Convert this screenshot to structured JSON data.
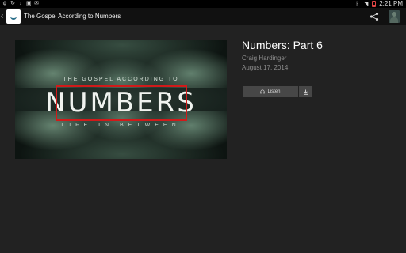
{
  "status_bar": {
    "time": "2:21 PM",
    "icons": [
      "usb-icon",
      "sync-icon",
      "download-notification-icon",
      "image-icon",
      "mail-icon",
      "bluetooth-icon",
      "wifi-icon",
      "battery-icon"
    ]
  },
  "action_bar": {
    "title": "The Gospel According to Numbers"
  },
  "artwork": {
    "kicker": "THE GOSPEL ACCORDING TO",
    "title": "NUMBERS",
    "tagline": "LIFE IN BETWEEN"
  },
  "episode": {
    "title": "Numbers: Part 6",
    "author": "Craig Hardinger",
    "date": "August 17, 2014"
  },
  "actions": {
    "listen_label": "Listen"
  },
  "colors": {
    "background": "#222222",
    "action_bar": "#111111",
    "button": "#474747",
    "highlight_frame": "#d11a1a"
  }
}
